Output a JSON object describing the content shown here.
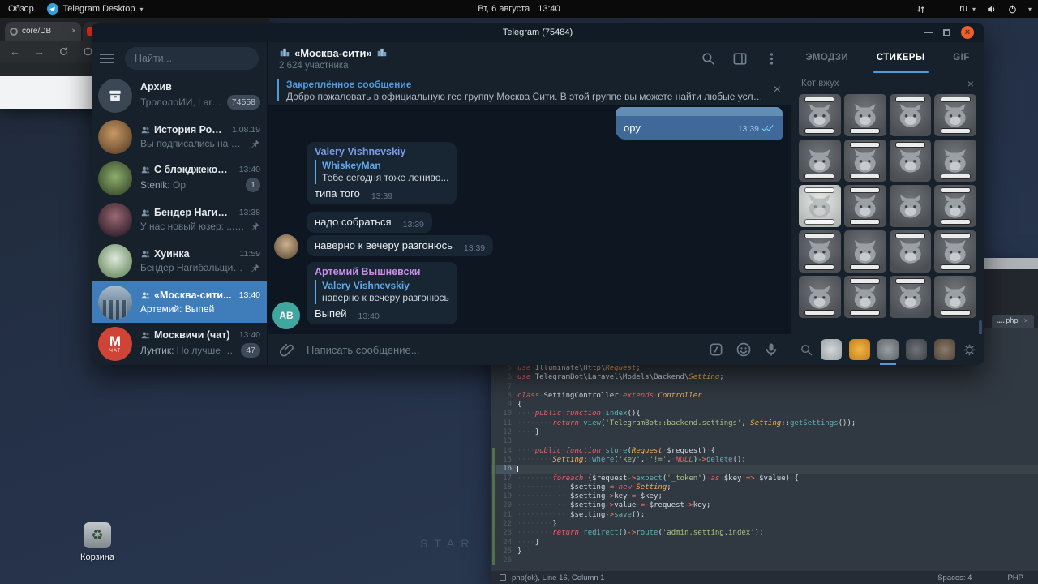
{
  "topbar": {
    "activities": "Обзор",
    "app_name": "Telegram Desktop",
    "clock_date": "Вт, 6 августа",
    "clock_time": "13:40",
    "keyboard_layout": "ru"
  },
  "browser": {
    "active_tab": "core/DB"
  },
  "desktop": {
    "trash_label": "Корзина",
    "wallpaper_text": "STAR"
  },
  "telegram": {
    "window_title": "Telegram (75484)",
    "search_placeholder": "Найти...",
    "chats": [
      {
        "name": "Архив",
        "preview": "ТрололоИИ, Larave...",
        "badge": "74558",
        "avatar": "archive"
      },
      {
        "name": "История Росси...",
        "time": "1.08.19",
        "preview": "Вы подписались на кан...",
        "pinned": true,
        "group": true,
        "avatar": "photo-history"
      },
      {
        "name": "С блэкджеком и ...",
        "time": "13:40",
        "preview_sender": "Stenik:",
        "preview": " Op",
        "badge": "1",
        "group": true,
        "avatar": "photo-blackjack"
      },
      {
        "name": "Бендер Нагибаль...",
        "time": "13:38",
        "preview": "У нас новый юзер: ..........",
        "pinned": true,
        "group": true,
        "avatar": "photo-bender"
      },
      {
        "name": "Хуинка",
        "time": "11:59",
        "preview": "Бендер Нагибальщик Р...",
        "pinned": true,
        "group": true,
        "avatar": "photo-huinka"
      },
      {
        "name": "«Москва-сити...",
        "time": "13:40",
        "preview_sender": "Артемий:",
        "preview": " Выпей",
        "selected": true,
        "group": true,
        "avatar": "photo-city"
      },
      {
        "name": "Москвичи (чат)",
        "time": "13:40",
        "preview_sender": "Лунтик:",
        "preview": " Но лучше бы в...",
        "badge": "47",
        "group": true,
        "avatar": "letter-m",
        "avatar_letter": "М",
        "avatar_sub": "ЧАТ"
      }
    ],
    "chat": {
      "title": "«Москва-сити»",
      "subtitle": "2 624 участника",
      "pinned_label": "Закреплённое сообщение",
      "pinned_text": "Добро пожаловать в официальную гео группу Москва Сити.   В этой группе вы можете найти любые услуги …",
      "input_placeholder": "Написать сообщение...",
      "messages": [
        {
          "dir": "out",
          "text": "ору",
          "time": "13:39",
          "read": true
        },
        {
          "dir": "in",
          "author": "Valery Vishnevskiy",
          "author_color": "#7c9be6",
          "reply_name": "WhiskeyMan",
          "reply_text": "Тебе сегодня тоже лениво...",
          "text": "типа того",
          "time": "13:39"
        },
        {
          "dir": "in",
          "text": "надо собраться",
          "time": "13:39"
        },
        {
          "dir": "in",
          "text": "наверно к вечеру разгонюсь",
          "time": "13:39",
          "avatar": "photo-man"
        },
        {
          "dir": "in",
          "author": "Артемий Вышневски",
          "author_color": "#cb8fe9",
          "reply_name": "Valery Vishnevskiy",
          "reply_text": "наверно к вечеру разгонюсь",
          "text": "Выпей",
          "time": "13:40",
          "avatar": "initials-av",
          "avatar_label": "АВ"
        }
      ]
    },
    "stickers": {
      "tabs": [
        "ЭМОДЗИ",
        "СТИКЕРЫ",
        "GIF"
      ],
      "active_tab_index": 1,
      "set_title": "Кот вжух",
      "grid_count": 20,
      "grid_columns": 4,
      "light_cells": [
        8
      ],
      "thumb_count": 5,
      "active_thumb_index": 2
    }
  },
  "editor": {
    "tab_label": "….php",
    "status_left": "php(ok), Line 16, Column 1",
    "status_spaces": "Spaces: 4",
    "status_lang": "PHP",
    "current_line": 16,
    "lines": [
      {
        "n": 5,
        "t": [
          [
            "kw",
            "use"
          ],
          [
            "pl",
            " Illuminate\\Http\\"
          ],
          [
            "type",
            "Request"
          ],
          [
            "pl",
            ";"
          ]
        ]
      },
      {
        "n": 6,
        "t": [
          [
            "kw",
            "use"
          ],
          [
            "pl",
            " TelegramBot\\Laravel\\Models\\Backend\\"
          ],
          [
            "type",
            "Setting"
          ],
          [
            "pl",
            ";"
          ]
        ]
      },
      {
        "n": 7,
        "t": []
      },
      {
        "n": 8,
        "t": [
          [
            "kw",
            "class"
          ],
          [
            "pl",
            " SettingController "
          ],
          [
            "kw",
            "extends"
          ],
          [
            "pl",
            " "
          ],
          [
            "type",
            "Controller"
          ]
        ]
      },
      {
        "n": 9,
        "t": [
          [
            "pl",
            "{"
          ]
        ]
      },
      {
        "n": 10,
        "t": [
          [
            "pl",
            "    "
          ],
          [
            "kw",
            "public"
          ],
          [
            "pl",
            " "
          ],
          [
            "kw",
            "function"
          ],
          [
            "pl",
            " "
          ],
          [
            "fn",
            "index"
          ],
          [
            "pl",
            "(){"
          ]
        ]
      },
      {
        "n": 11,
        "t": [
          [
            "pl",
            "        "
          ],
          [
            "kw",
            "return"
          ],
          [
            "pl",
            " "
          ],
          [
            "fn",
            "view"
          ],
          [
            "pl",
            "("
          ],
          [
            "str",
            "'TelegramBot::backend.settings'"
          ],
          [
            "pl",
            ", "
          ],
          [
            "type",
            "Setting"
          ],
          [
            "pl",
            "::"
          ],
          [
            "fn",
            "getSettings"
          ],
          [
            "pl",
            "());"
          ]
        ]
      },
      {
        "n": 12,
        "t": [
          [
            "pl",
            "    }"
          ]
        ]
      },
      {
        "n": 13,
        "t": []
      },
      {
        "n": 14,
        "t": [
          [
            "pl",
            "    "
          ],
          [
            "kw",
            "public"
          ],
          [
            "pl",
            " "
          ],
          [
            "kw",
            "function"
          ],
          [
            "pl",
            " "
          ],
          [
            "fn",
            "store"
          ],
          [
            "pl",
            "("
          ],
          [
            "type",
            "Request"
          ],
          [
            "pl",
            " $request) {"
          ]
        ]
      },
      {
        "n": 15,
        "t": [
          [
            "pl",
            "        "
          ],
          [
            "type",
            "Setting"
          ],
          [
            "pl",
            "::"
          ],
          [
            "fn",
            "where"
          ],
          [
            "pl",
            "("
          ],
          [
            "str",
            "'key'"
          ],
          [
            "pl",
            ", "
          ],
          [
            "str",
            "'!='"
          ],
          [
            "pl",
            ", "
          ],
          [
            "cs",
            "NULL"
          ],
          [
            "pl",
            ")"
          ],
          [
            "op",
            "->"
          ],
          [
            "fn",
            "delete"
          ],
          [
            "pl",
            "();"
          ]
        ]
      },
      {
        "n": 16,
        "t": []
      },
      {
        "n": 17,
        "t": [
          [
            "pl",
            "        "
          ],
          [
            "kw",
            "foreach"
          ],
          [
            "pl",
            " ($request"
          ],
          [
            "op",
            "->"
          ],
          [
            "fn",
            "expect"
          ],
          [
            "pl",
            "("
          ],
          [
            "str",
            "'_token'"
          ],
          [
            "pl",
            ") "
          ],
          [
            "kw",
            "as"
          ],
          [
            "pl",
            " $key "
          ],
          [
            "op",
            "=>"
          ],
          [
            "pl",
            " $value) {"
          ]
        ]
      },
      {
        "n": 18,
        "t": [
          [
            "pl",
            "            $setting "
          ],
          [
            "op",
            "="
          ],
          [
            "pl",
            " "
          ],
          [
            "kw",
            "new"
          ],
          [
            "pl",
            " "
          ],
          [
            "type",
            "Setting"
          ],
          [
            "pl",
            ";"
          ]
        ]
      },
      {
        "n": 19,
        "t": [
          [
            "pl",
            "            $setting"
          ],
          [
            "op",
            "->"
          ],
          [
            "pl",
            "key "
          ],
          [
            "op",
            "="
          ],
          [
            "pl",
            " $key;"
          ]
        ]
      },
      {
        "n": 20,
        "t": [
          [
            "pl",
            "            $setting"
          ],
          [
            "op",
            "->"
          ],
          [
            "pl",
            "value "
          ],
          [
            "op",
            "="
          ],
          [
            "pl",
            " $request"
          ],
          [
            "op",
            "->"
          ],
          [
            "pl",
            "key;"
          ]
        ]
      },
      {
        "n": 21,
        "t": [
          [
            "pl",
            "            $setting"
          ],
          [
            "op",
            "->"
          ],
          [
            "fn",
            "save"
          ],
          [
            "pl",
            "();"
          ]
        ]
      },
      {
        "n": 22,
        "t": [
          [
            "pl",
            "        }"
          ]
        ]
      },
      {
        "n": 23,
        "t": [
          [
            "pl",
            "        "
          ],
          [
            "kw",
            "return"
          ],
          [
            "pl",
            " "
          ],
          [
            "fn",
            "redirect"
          ],
          [
            "pl",
            "()"
          ],
          [
            "op",
            "->"
          ],
          [
            "fn",
            "route"
          ],
          [
            "pl",
            "("
          ],
          [
            "str",
            "'admin.setting.index'"
          ],
          [
            "pl",
            ");"
          ]
        ]
      },
      {
        "n": 24,
        "t": [
          [
            "pl",
            "    }"
          ]
        ]
      },
      {
        "n": 25,
        "t": [
          [
            "pl",
            "}"
          ]
        ]
      },
      {
        "n": 26,
        "t": []
      }
    ]
  },
  "accent_colors": {
    "telegram_accent": "#4e9cdf",
    "selected_chat": "#3f7cba",
    "outgoing_bubble": "#40699a",
    "incoming_bubble": "#182533",
    "close_button": "#ec5e2a"
  }
}
